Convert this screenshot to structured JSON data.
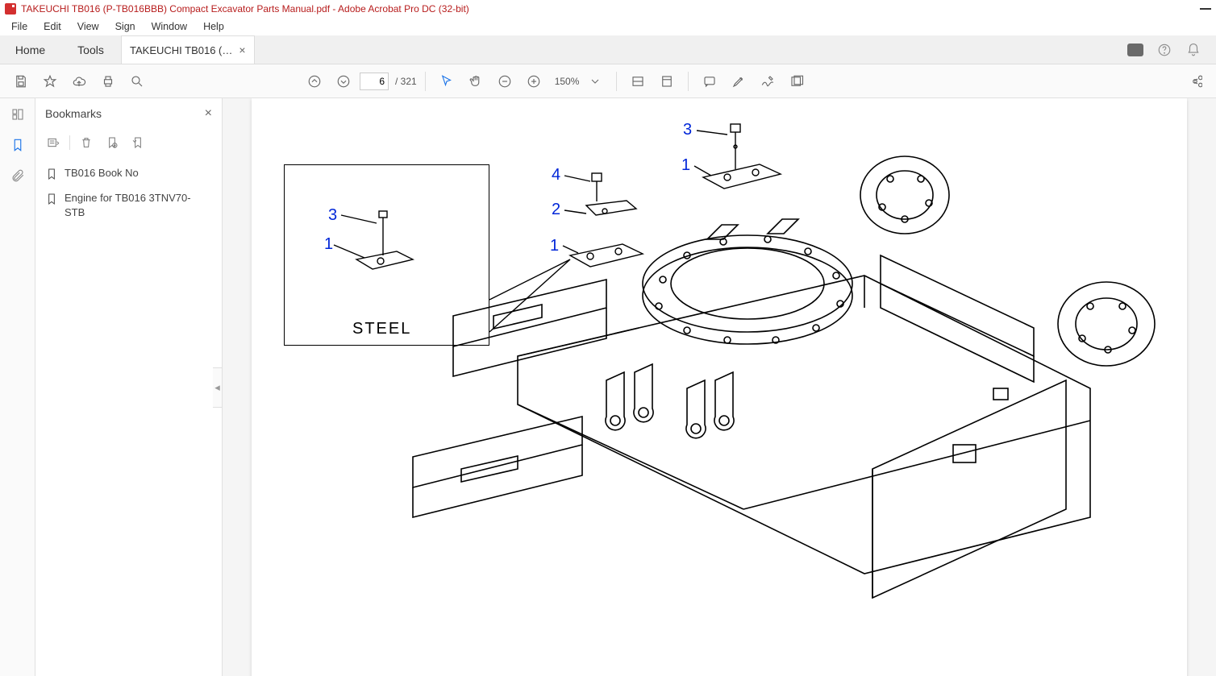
{
  "window": {
    "title": "TAKEUCHI TB016 (P-TB016BBB) Compact Excavator Parts Manual.pdf - Adobe Acrobat Pro DC (32-bit)"
  },
  "menu": {
    "file": "File",
    "edit": "Edit",
    "view": "View",
    "sign": "Sign",
    "window": "Window",
    "help": "Help"
  },
  "tabs": {
    "home": "Home",
    "tools": "Tools",
    "doc": "TAKEUCHI TB016 (…"
  },
  "toolbar": {
    "page_current": "6",
    "page_total": "/ 321",
    "zoom": "150%"
  },
  "sidepanel": {
    "title": "Bookmarks",
    "bookmarks": [
      {
        "label": "TB016  Book No"
      },
      {
        "label": "Engine for TB016 3TNV70- STB"
      }
    ]
  },
  "diagram": {
    "box_label": "STEEL",
    "callouts_box": {
      "c1": "1",
      "c3": "3"
    },
    "callouts_main": {
      "c1a": "1",
      "c1b": "1",
      "c2": "2",
      "c3": "3",
      "c4": "4"
    }
  }
}
